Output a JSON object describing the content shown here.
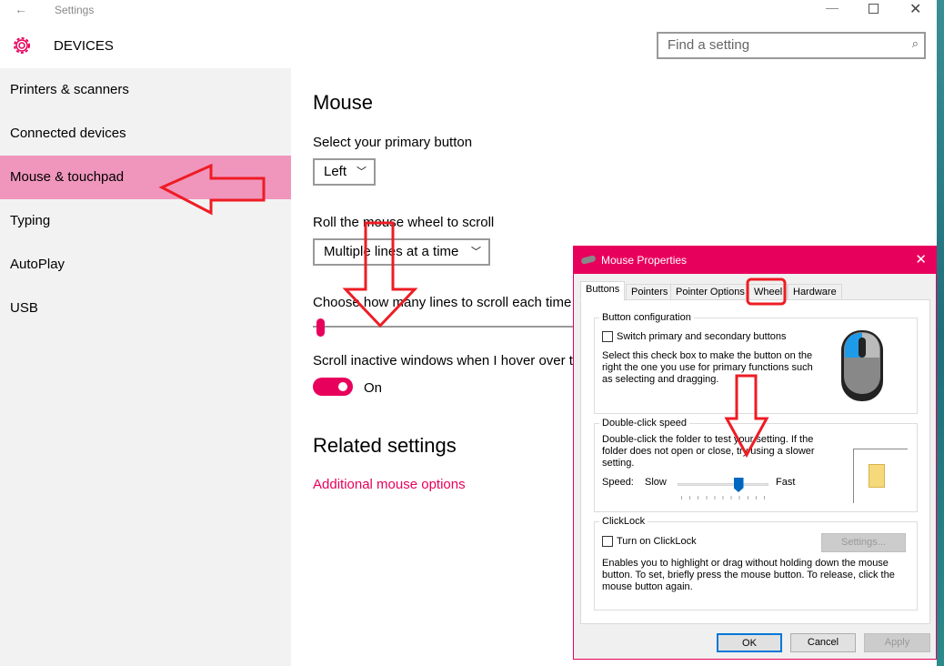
{
  "window": {
    "title": "Settings",
    "back_icon": "arrow-left-icon",
    "minimize_icon": "minimize-icon",
    "maximize_icon": "maximize-icon",
    "close_icon": "close-icon"
  },
  "header": {
    "icon": "gear-icon",
    "title": "DEVICES",
    "search_placeholder": "Find a setting",
    "search_icon": "search-icon"
  },
  "sidebar": {
    "items": [
      {
        "label": "Printers & scanners"
      },
      {
        "label": "Connected devices"
      },
      {
        "label": "Mouse & touchpad",
        "active": true
      },
      {
        "label": "Typing"
      },
      {
        "label": "AutoPlay"
      },
      {
        "label": "USB"
      }
    ]
  },
  "main": {
    "title": "Mouse",
    "primary_label": "Select your primary button",
    "primary_value": "Left",
    "wheel_label": "Roll the mouse wheel to scroll",
    "wheel_value": "Multiple lines at a time",
    "lines_label": "Choose how many lines to scroll each time",
    "lines_value_fraction": 0.03,
    "inactive_label": "Scroll inactive windows when I hover over them",
    "inactive_state": "On",
    "related_title": "Related settings",
    "related_link": "Additional mouse options"
  },
  "accent": "#e8005d",
  "dialog": {
    "title": "Mouse Properties",
    "tabs": [
      "Buttons",
      "Pointers",
      "Pointer Options",
      "Wheel",
      "Hardware"
    ],
    "active_tab": "Buttons",
    "button_config": {
      "legend": "Button configuration",
      "checkbox": "Switch primary and secondary buttons",
      "checked": false,
      "desc": "Select this check box to make the button on the right the one you use for primary functions such as selecting and dragging."
    },
    "double_click": {
      "legend": "Double-click speed",
      "desc": "Double-click the folder to test your setting. If the folder does not open or close, try using a slower setting.",
      "speed_label": "Speed:",
      "slow": "Slow",
      "fast": "Fast",
      "speed_value": 0.7
    },
    "clicklock": {
      "legend": "ClickLock",
      "checkbox": "Turn on ClickLock",
      "checked": false,
      "settings_button": "Settings...",
      "desc": "Enables you to highlight or drag without holding down the mouse button. To set, briefly press the mouse button. To release, click the mouse button again."
    },
    "buttons": {
      "ok": "OK",
      "cancel": "Cancel",
      "apply": "Apply"
    }
  },
  "annotation_color": "#ee1c24"
}
